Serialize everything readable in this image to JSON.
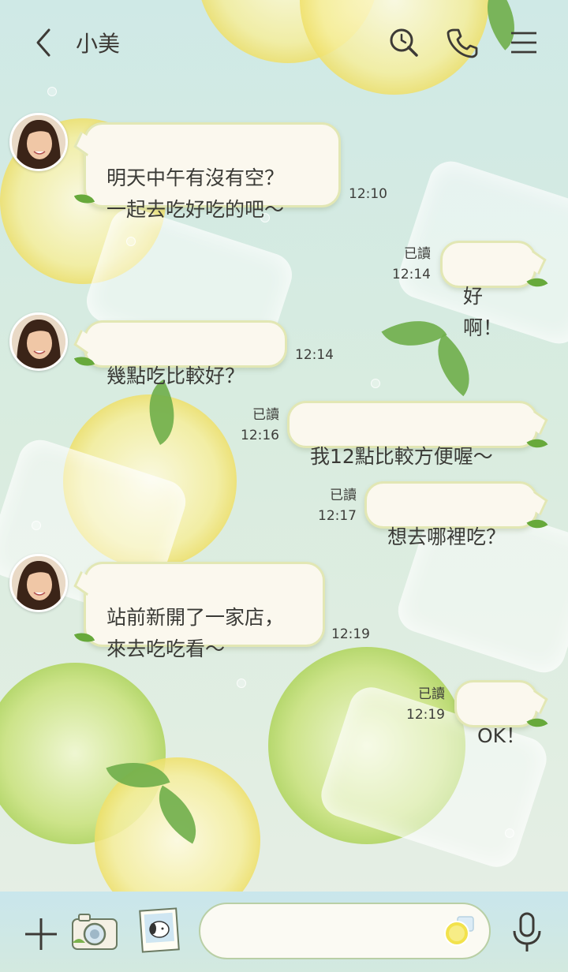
{
  "header": {
    "title": "小美"
  },
  "messages": [
    {
      "side": "in",
      "text": "明天中午有沒有空？\n一起去吃好吃的吧～",
      "time": "12:10",
      "read": ""
    },
    {
      "side": "out",
      "text": "好啊！",
      "time": "12:14",
      "read": "已讀"
    },
    {
      "side": "in",
      "text": "幾點吃比較好？",
      "time": "12:14",
      "read": ""
    },
    {
      "side": "out",
      "text": "我12點比較方便喔～",
      "time": "12:16",
      "read": "已讀"
    },
    {
      "side": "out",
      "text": "想去哪裡吃？",
      "time": "12:17",
      "read": "已讀"
    },
    {
      "side": "in",
      "text": "站前新開了一家店，\n來去吃吃看～",
      "time": "12:19",
      "read": ""
    },
    {
      "side": "out",
      "text": "OK！",
      "time": "12:19",
      "read": "已讀"
    }
  ],
  "icons": {
    "back": "chevron-left-icon",
    "search": "search-icon",
    "call": "phone-icon",
    "menu": "menu-icon",
    "add": "plus-icon",
    "camera": "camera-icon",
    "photo": "photo-icon",
    "emoji": "emoji-icon",
    "mic": "microphone-icon"
  },
  "colors": {
    "bubble": "#fbf8ee",
    "bubble_border": "#e2e7b4",
    "leaf": "#67a93b"
  }
}
